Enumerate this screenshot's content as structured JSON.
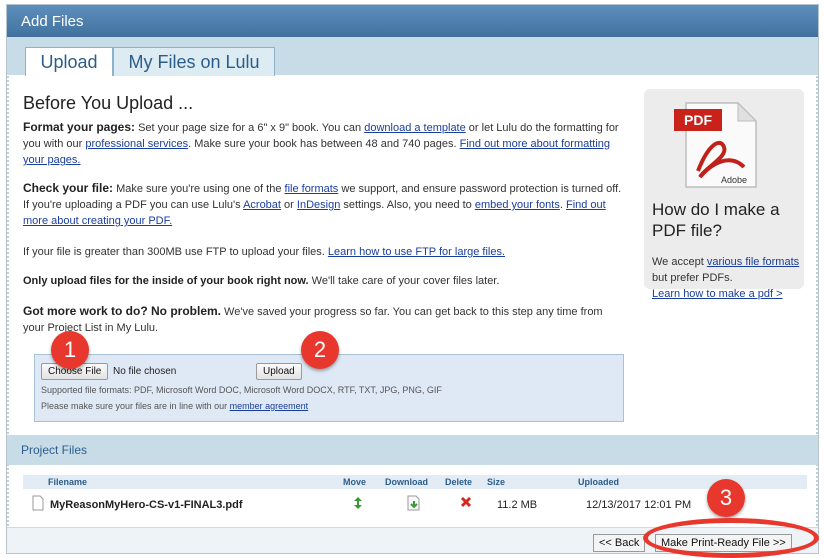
{
  "window": {
    "title": "Add Files"
  },
  "tabs": [
    {
      "label": "Upload"
    },
    {
      "label": "My Files on Lulu"
    }
  ],
  "main": {
    "heading": "Before You Upload ...",
    "format": {
      "lead": "Format your pages:",
      "text1": " Set your page size for a 6\" x 9\" book. You can ",
      "link1": "download a template",
      "text2": " or let Lulu do the formatting for you with our ",
      "link2": "professional services",
      "text3": ". Make sure your book has between 48 and 740 pages. ",
      "link3": "Find out more about formatting your pages."
    },
    "check": {
      "lead": "Check your file:",
      "text1": " Make sure you're using one of the ",
      "link1": "file formats",
      "text2": " we support, and ensure password protection is turned off. If you're uploading a PDF you can use Lulu's ",
      "link2": "Acrobat",
      "text3": " or ",
      "link3": "InDesign",
      "text4": " settings. Also, you need to ",
      "link4": "embed your fonts",
      "text5": ". ",
      "link5": "Find out more about creating your PDF."
    },
    "ftp": {
      "text": "If your file is greater than 300MB use FTP to upload your files. ",
      "link": "Learn how to use FTP for large files."
    },
    "inside": {
      "lead": "Only upload files for the inside of your book right now.",
      "text": " We'll take care of your cover files later."
    },
    "more": {
      "lead": "Got more work to do? No problem.",
      "text": " We've saved your progress so far. You can get back to this step any time from your Project List in My Lulu."
    }
  },
  "upload": {
    "choose_label": "Choose File",
    "no_file": "No file chosen",
    "upload_label": "Upload",
    "formats": "Supported file formats: PDF, Microsoft Word DOC, Microsoft Word DOCX, RTF, TXT, JPG, PNG, GIF",
    "agreement_text": "Please make sure your files are in line with our ",
    "agreement_link": "member agreement"
  },
  "pdf_panel": {
    "icon_label_top": "PDF",
    "icon_label_bottom": "Adobe",
    "question": "How do I make a PDF file?",
    "text1": "We accept ",
    "link1": "various file formats",
    "text2": " but prefer PDFs.",
    "link2": "Learn how to make a pdf >"
  },
  "project": {
    "title": "Project Files",
    "headers": [
      "Filename",
      "Move",
      "Download",
      "Delete",
      "Size",
      "Uploaded"
    ],
    "rows": [
      {
        "filename": "MyReasonMyHero-CS-v1-FINAL3.pdf",
        "size": "11.2 MB",
        "uploaded": "12/13/2017 12:01 PM"
      }
    ]
  },
  "nav": {
    "back_label": "<< Back",
    "next_label": "Make Print-Ready File >>"
  },
  "annotations": {
    "one": "1",
    "two": "2",
    "three": "3"
  },
  "colors": {
    "accent_red": "#e8382e",
    "link_blue": "#1a3e9c",
    "header_blue": "#41729f"
  }
}
